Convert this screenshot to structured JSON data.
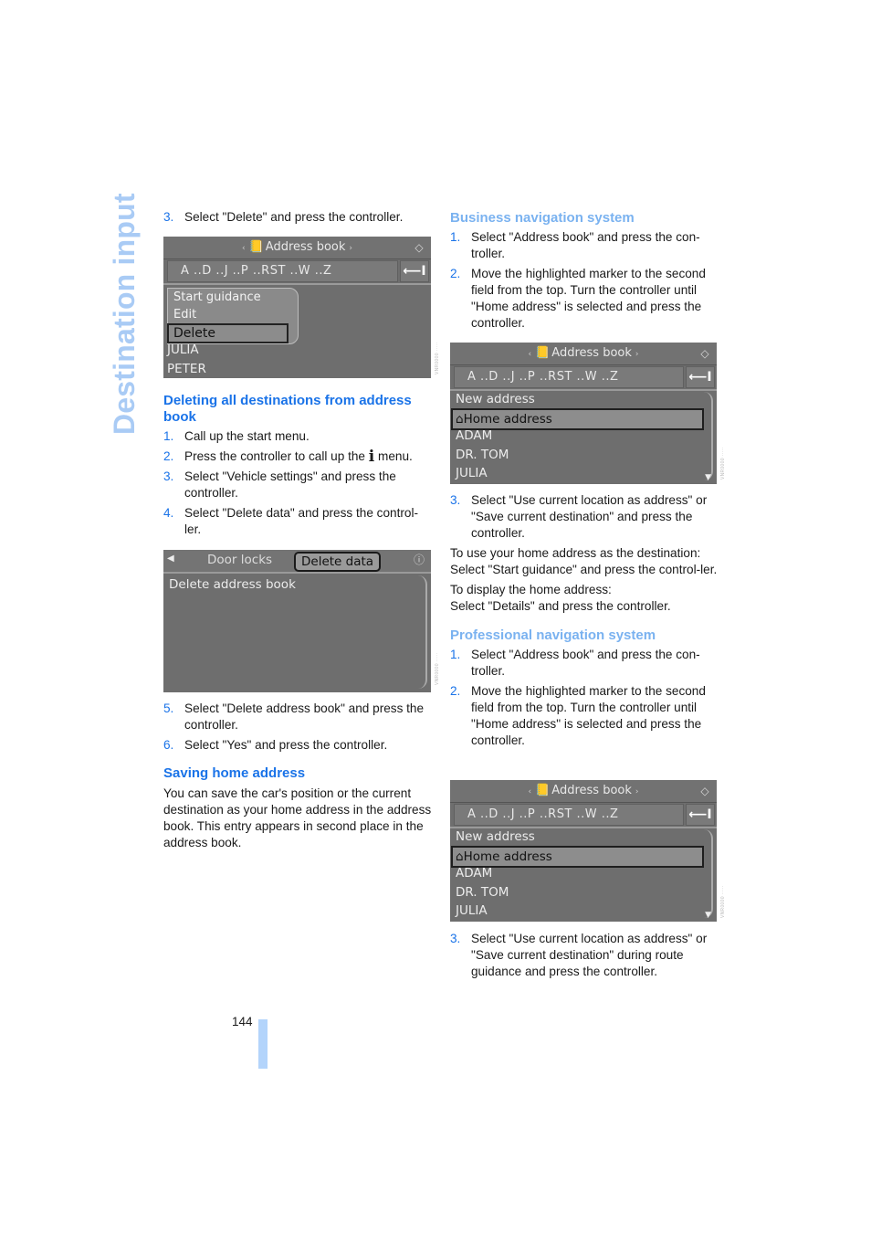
{
  "section_title": "Destination input",
  "page_number": "144",
  "left": {
    "step3": {
      "num": "3.",
      "text": "Select \"Delete\" and press the controller."
    },
    "screen1": {
      "header_left_arrow": "‹",
      "header_icon": "address-book-icon",
      "header_title": "Address book",
      "header_right_arrow": "›",
      "alpha": "A ..D ..J ..P ..RST ..W ..Z",
      "back_symbol": "⟵I",
      "popup_items": [
        "Start guidance",
        "Edit",
        "Delete"
      ],
      "popup_selected": "Delete",
      "list": [
        "JULIA",
        "PETER"
      ]
    },
    "heading_delete_all": "Deleting all destinations from address book",
    "delete_steps": [
      {
        "num": "1.",
        "text": "Call up the start menu."
      },
      {
        "num": "2.",
        "text_before": "Press the controller to call up the ",
        "icon": "i",
        "text_after": " menu."
      },
      {
        "num": "3.",
        "text": "Select \"Vehicle settings\" and press the controller."
      },
      {
        "num": "4.",
        "text": "Select \"Delete data\" and press the control-ler."
      }
    ],
    "screen2": {
      "tabs": [
        "Door locks",
        "Delete data"
      ],
      "active_tab": "Delete data",
      "rows": [
        "Delete address book"
      ]
    },
    "delete_steps_2": [
      {
        "num": "5.",
        "text": "Select \"Delete address book\" and press the controller."
      },
      {
        "num": "6.",
        "text": "Select \"Yes\" and press the controller."
      }
    ],
    "heading_saving": "Saving home address",
    "saving_text": "You can save the car's position or the current destination as your home address in the address book. This entry appears in second place in the address book."
  },
  "right": {
    "heading_business": "Business navigation system",
    "business_steps": [
      {
        "num": "1.",
        "text": "Select \"Address book\" and press the con-troller."
      },
      {
        "num": "2.",
        "text": "Move the highlighted marker to the second field from the top. Turn the controller until \"Home address\" is selected and press the controller."
      }
    ],
    "screen3": {
      "header_title": "Address book",
      "alpha": "A ..D ..J ..P ..RST ..W ..Z",
      "back_symbol": "⟵I",
      "rows": [
        "New address",
        "Home address",
        "ADAM",
        "DR. TOM",
        "JULIA"
      ],
      "selected": "Home address"
    },
    "business_step3": {
      "num": "3.",
      "text": "Select \"Use current location as address\" or \"Save current destination\" and press the controller."
    },
    "use_home_text": [
      "To use your home address as the destination:",
      "Select \"Start guidance\" and press the control-ler."
    ],
    "display_home_text": [
      "To display the home address:",
      "Select \"Details\" and press the controller."
    ],
    "heading_professional": "Professional navigation system",
    "professional_steps": [
      {
        "num": "1.",
        "text": "Select \"Address book\" and press the con-troller."
      },
      {
        "num": "2.",
        "text": "Move the highlighted marker to the second field from the top. Turn the controller until \"Home address\" is selected and press the controller."
      }
    ],
    "screen4": {
      "header_title": "Address book",
      "alpha": "A ..D ..J ..P ..RST ..W ..Z",
      "back_symbol": "⟵I",
      "rows": [
        "New address",
        "Home address",
        "ADAM",
        "DR. TOM",
        "JULIA"
      ],
      "selected": "Home address"
    },
    "professional_step3": {
      "num": "3.",
      "text": "Select \"Use current location as address\" or \"Save current destination\" during route guidance and press the controller."
    }
  },
  "colors": {
    "heading_blue": "#1a73e8",
    "light_blue": "#7ab2f0",
    "side_title": "#a9cbf5",
    "screen_grey": "#6e6e6e"
  }
}
